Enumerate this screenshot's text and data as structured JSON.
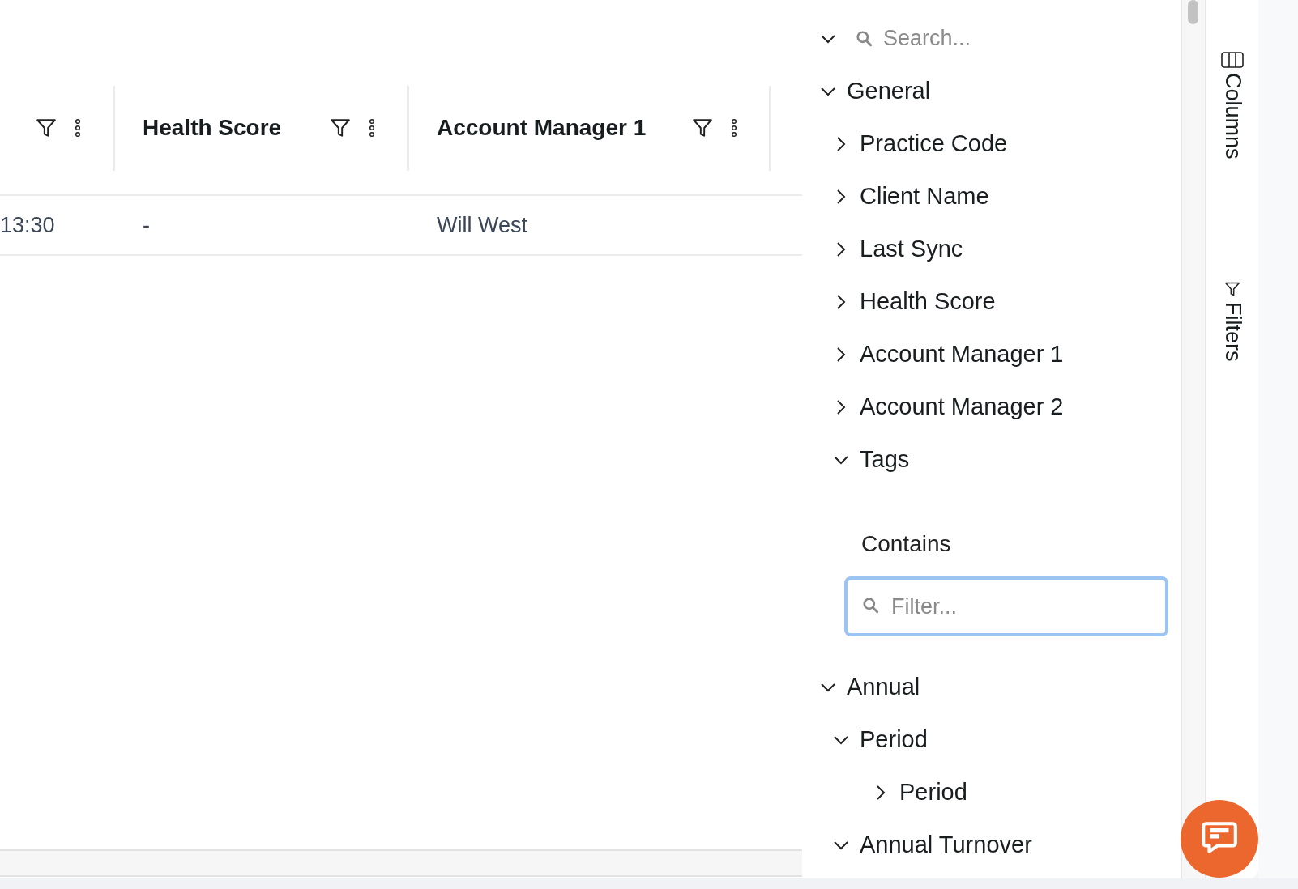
{
  "grid": {
    "columns": [
      {},
      {
        "label": "Health Score"
      },
      {
        "label": "Account Manager 1"
      },
      {}
    ],
    "rows": [
      {
        "cells": [
          "13:30",
          "-",
          "Will West",
          ""
        ]
      }
    ]
  },
  "tool_panel": {
    "search": {
      "placeholder": "Search...",
      "expanded": true
    },
    "tree": [
      {
        "kind": "group",
        "label": "General",
        "expanded": true,
        "children": [
          {
            "kind": "group",
            "label": "Practice Code",
            "expanded": false
          },
          {
            "kind": "group",
            "label": "Client Name",
            "expanded": false
          },
          {
            "kind": "group",
            "label": "Last Sync",
            "expanded": false
          },
          {
            "kind": "group",
            "label": "Health Score",
            "expanded": false
          },
          {
            "kind": "group",
            "label": "Account Manager 1",
            "expanded": false
          },
          {
            "kind": "group",
            "label": "Account Manager 2",
            "expanded": false
          },
          {
            "kind": "group",
            "label": "Tags",
            "expanded": true,
            "children": [
              {
                "kind": "filter",
                "label": "Contains",
                "placeholder": "Filter..."
              }
            ]
          }
        ]
      },
      {
        "kind": "group",
        "label": "Annual",
        "expanded": true,
        "children": [
          {
            "kind": "group",
            "label": "Period",
            "expanded": true,
            "children": [
              {
                "kind": "group",
                "label": "Period",
                "expanded": false
              }
            ]
          },
          {
            "kind": "group",
            "label": "Annual Turnover",
            "expanded": true
          }
        ]
      }
    ]
  },
  "side_tabs": [
    {
      "kind": "columns",
      "label": "Columns"
    },
    {
      "kind": "filters",
      "label": "Filters"
    }
  ]
}
